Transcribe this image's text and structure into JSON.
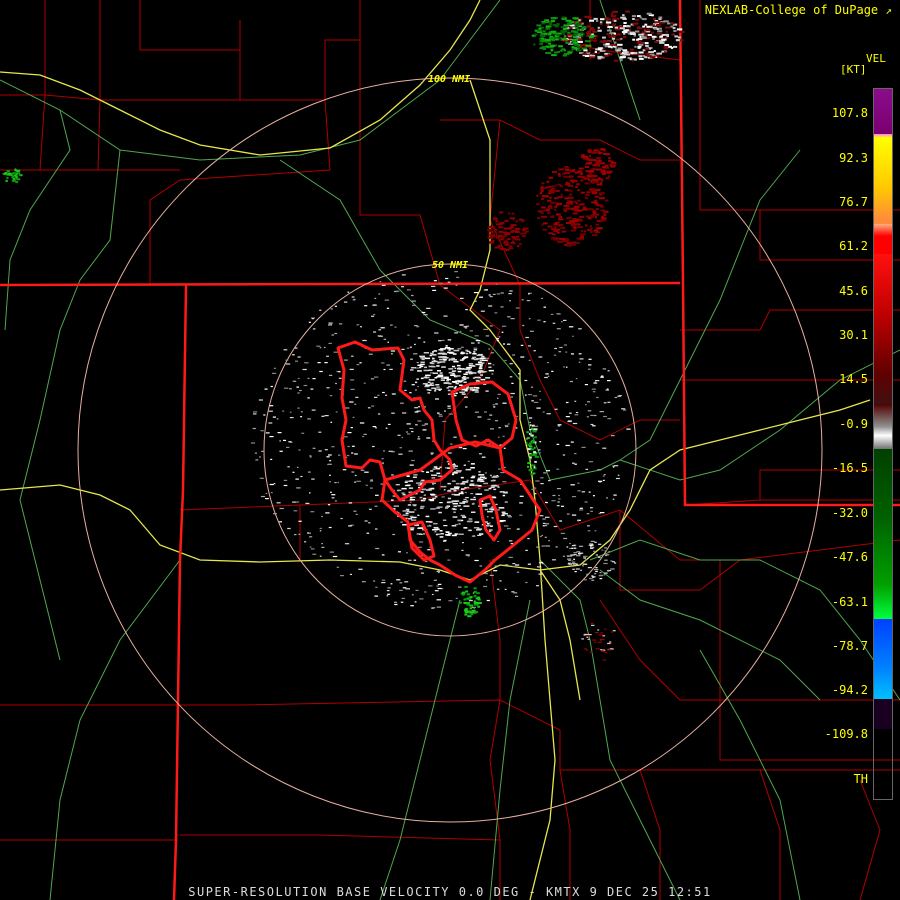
{
  "attribution": "NEXLAB-College of DuPage",
  "attribution_icon": "external-link-icon",
  "product_title": "SUPER-RESOLUTION BASE VELOCITY 0.0 DEG - KMTX 9 DEC 25 12:51",
  "legend": {
    "product": "VEL",
    "unit": "[KT]",
    "ticks": [
      "107.8",
      "92.3",
      "76.7",
      "61.2",
      "45.6",
      "30.1",
      "14.5",
      "-0.9",
      "-16.5",
      "-32.0",
      "-47.6",
      "-63.1",
      "-78.7",
      "-94.2",
      "-109.8",
      "TH"
    ]
  },
  "range_rings": [
    {
      "label": "50 NMI"
    },
    {
      "label": "100 NMI"
    }
  ],
  "colors": {
    "state_border": "#ff1a1a",
    "county_border": "#b00000",
    "highway": "#e6e64d",
    "road": "#5fb35f",
    "range_ring": "#e8b0a0",
    "warning_polygon": "#ff1a1a",
    "text": "#ffff00"
  }
}
